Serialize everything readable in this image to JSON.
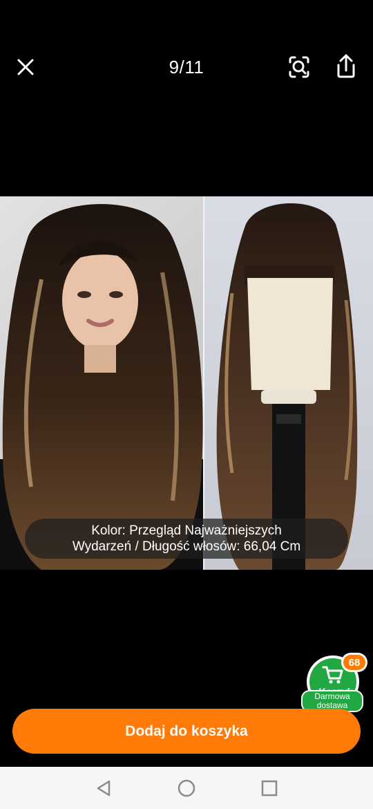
{
  "header": {
    "counter": "9/11",
    "close_icon": "close-icon",
    "lens_icon": "visual-search-icon",
    "share_icon": "share-icon"
  },
  "gallery": {
    "caption_line1": "Kolor: Przegląd Najważniejszych",
    "caption_line2": "Wydarzeń / Długość włosów: 66,04 Cm"
  },
  "cart_widget": {
    "badge_count": "68",
    "label": "Koszyk",
    "free_line1": "Darmowa",
    "free_line2": "dostawa",
    "accent": "#22a842",
    "badge_color": "#ff7a00"
  },
  "action": {
    "add_label": "Dodaj do koszyka",
    "accent": "#ff7a06"
  },
  "system_nav": {
    "back_icon": "back-triangle-icon",
    "home_icon": "home-circle-icon",
    "recents_icon": "recents-square-icon"
  }
}
